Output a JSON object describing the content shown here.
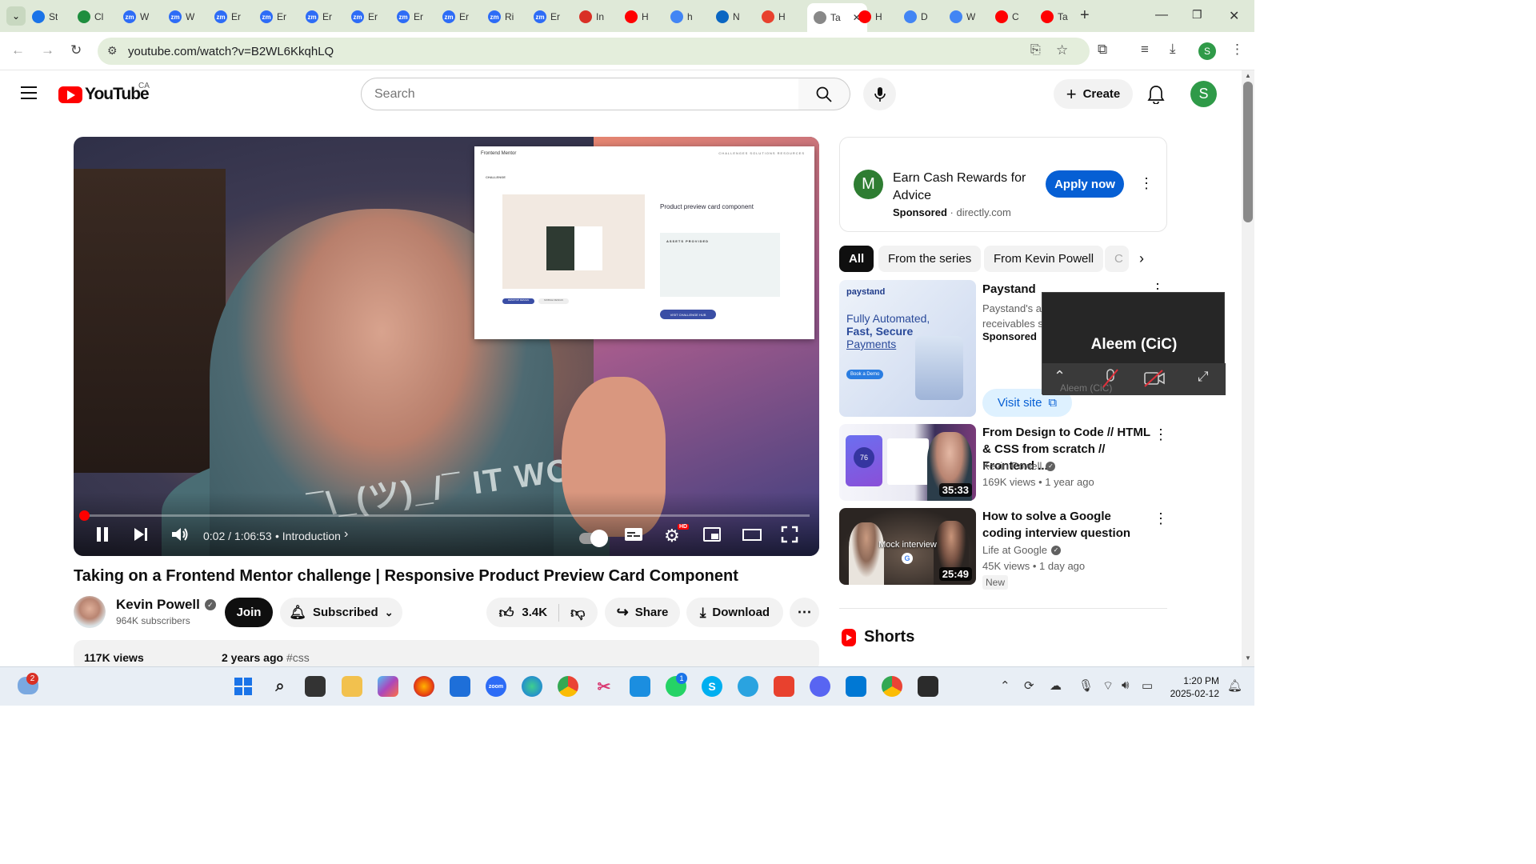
{
  "browser": {
    "tabs": [
      {
        "label": "St",
        "icon": "google-c"
      },
      {
        "label": "Cl",
        "icon": "drive"
      },
      {
        "label": "W",
        "icon": "zoom"
      },
      {
        "label": "W",
        "icon": "zoom"
      },
      {
        "label": "Er",
        "icon": "zoom"
      },
      {
        "label": "Er",
        "icon": "zoom"
      },
      {
        "label": "Er",
        "icon": "zoom"
      },
      {
        "label": "Er",
        "icon": "zoom"
      },
      {
        "label": "Er",
        "icon": "zoom"
      },
      {
        "label": "Er",
        "icon": "zoom"
      },
      {
        "label": "Ri",
        "icon": "zoom"
      },
      {
        "label": "Er",
        "icon": "zoom"
      },
      {
        "label": "In",
        "icon": "gmail"
      },
      {
        "label": "H",
        "icon": "youtube"
      },
      {
        "label": "h",
        "icon": "google"
      },
      {
        "label": "N",
        "icon": "linkedin"
      },
      {
        "label": "H",
        "icon": "settings"
      },
      {
        "label": "Ta",
        "icon": "active"
      },
      {
        "label": "H",
        "icon": "youtube"
      },
      {
        "label": "D",
        "icon": "docs"
      },
      {
        "label": "W",
        "icon": "docs"
      },
      {
        "label": "C",
        "icon": "youtube"
      },
      {
        "label": "Ta",
        "icon": "youtube"
      }
    ],
    "url": "youtube.com/watch?v=B2WL6KkqhLQ",
    "profile_initial": "S"
  },
  "youtube": {
    "logo_text": "YouTube",
    "country_code": "CA",
    "search_placeholder": "Search",
    "create_label": "Create",
    "avatar_initial": "S"
  },
  "player": {
    "slide": {
      "brand": "Frontend Mentor",
      "nav": "CHALLENGES   SOLUTIONS   RESOURCES",
      "section": "CHALLENGE",
      "title": "Product preview card component",
      "assets_heading": "ASSETS PROVIDED",
      "cta": "VISIT CHALLENGE HUB",
      "tab_desktop": "DESKTOP DESIGN",
      "tab_mobile": "MOBILE DESIGN"
    },
    "shirt_text": "¯\\_(ツ)_/¯  IT WORKS",
    "progress_fraction": 0.0005,
    "timecode": "0:02 / 1:06:53",
    "chapter": "• Introduction",
    "hd_badge": "HD"
  },
  "video": {
    "title": "Taking on a Frontend Mentor challenge | Responsive Product Preview Card Component",
    "channel": "Kevin Powell",
    "subscribers": "964K subscribers",
    "join_label": "Join",
    "subscribed_label": "Subscribed",
    "likes": "3.4K",
    "share_label": "Share",
    "download_label": "Download",
    "views": "117K views",
    "age": "2 years ago",
    "hashtag": "#css"
  },
  "ad": {
    "logo_letter": "M",
    "title": "Earn Cash Rewards for Advice",
    "sponsored": "Sponsored",
    "domain": "directly.com",
    "cta": "Apply now"
  },
  "chips": [
    "All",
    "From the series",
    "From Kevin Powell",
    "C"
  ],
  "sponsored_video": {
    "thumb_brand": "paystand",
    "thumb_line1": "Fully Automated,",
    "thumb_line2": "Fast, Secure",
    "thumb_line3": "Payments",
    "thumb_cta": "Book a Demo",
    "title": "Paystand",
    "desc_line1": "Paystand's au",
    "desc_line2": "receivables se",
    "sponsored": "Sponsored",
    "visit_label": "Visit site"
  },
  "recommendations": [
    {
      "title": "From Design to Code // HTML & CSS from scratch // Frontend ...",
      "channel": "Kevin Powell",
      "meta": "169K views • 1 year ago",
      "duration": "35:33",
      "thumb_score": "76"
    },
    {
      "title": "How to solve a Google coding interview question",
      "channel": "Life at Google",
      "meta": "45K views • 1 day ago",
      "duration": "25:49",
      "badge": "New",
      "thumb_label": "Mock interview"
    }
  ],
  "shorts_label": "Shorts",
  "call_popup": {
    "name": "Aleem (CiC)",
    "label": "Aleem (CiC)"
  },
  "taskbar": {
    "notification_count": "2",
    "whatsapp_badge": "1",
    "time": "1:20 PM",
    "date": "2025-02-12"
  },
  "colors": {
    "youtube_red": "#ff0000",
    "apply_blue": "#065fd4",
    "chrome_tabstrip": "#dfe9d8"
  }
}
